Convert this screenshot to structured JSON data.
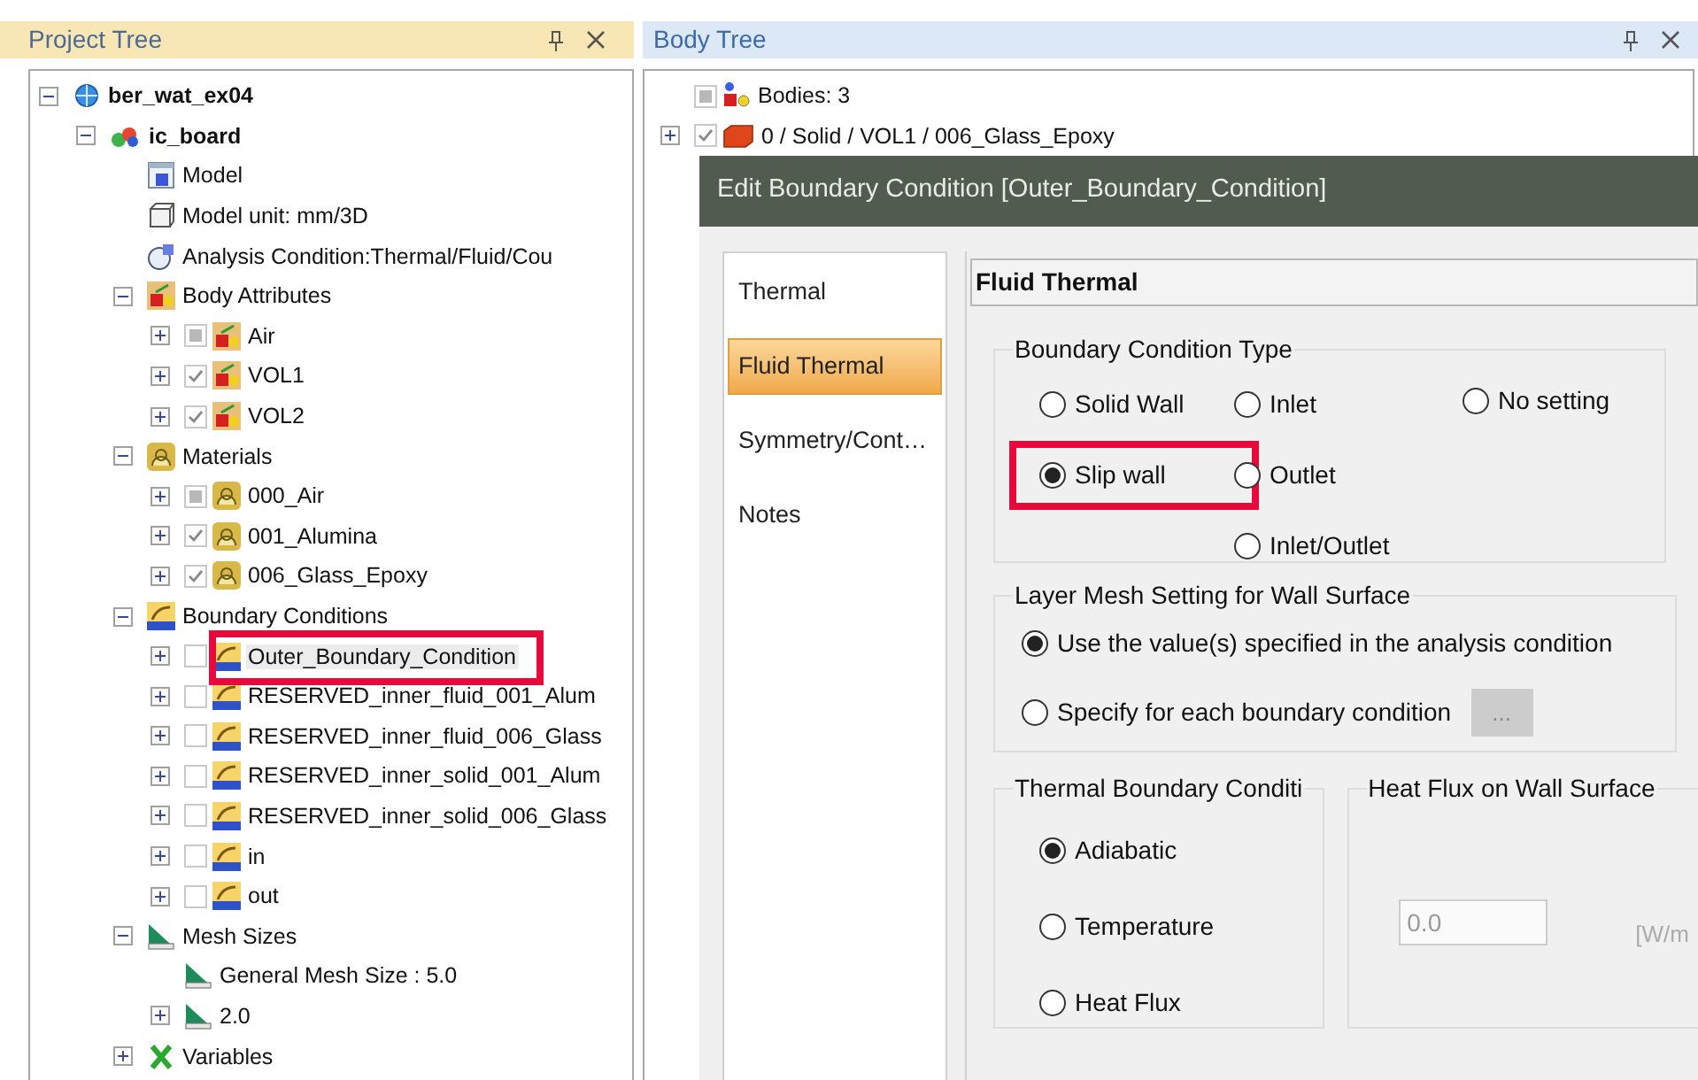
{
  "project_tree": {
    "title": "Project Tree",
    "items": [
      {
        "label": "ber_wat_ex04",
        "kind": "project",
        "bold": true,
        "expanded": true,
        "children": [
          {
            "label": "ic_board",
            "kind": "assembly",
            "bold": true,
            "expanded": true,
            "children": [
              {
                "label": "Model",
                "kind": "model"
              },
              {
                "label": "Model unit: mm/3D",
                "kind": "unit"
              },
              {
                "label": "Analysis Condition:Thermal/Fluid/Cou",
                "kind": "analysis"
              },
              {
                "label": "Body Attributes",
                "kind": "body",
                "expanded": true,
                "children": [
                  {
                    "label": "Air",
                    "kind": "body",
                    "checked": false,
                    "partial": true,
                    "expanded": false
                  },
                  {
                    "label": "VOL1",
                    "kind": "body",
                    "checked": true,
                    "expanded": false
                  },
                  {
                    "label": "VOL2",
                    "kind": "body",
                    "checked": true,
                    "expanded": false
                  }
                ]
              },
              {
                "label": "Materials",
                "kind": "material",
                "expanded": true,
                "children": [
                  {
                    "label": "000_Air",
                    "kind": "material",
                    "checked": false,
                    "partial": true,
                    "expanded": false
                  },
                  {
                    "label": "001_Alumina",
                    "kind": "material",
                    "checked": true,
                    "expanded": false
                  },
                  {
                    "label": "006_Glass_Epoxy",
                    "kind": "material",
                    "checked": true,
                    "expanded": false
                  }
                ]
              },
              {
                "label": "Boundary Conditions",
                "kind": "boundary",
                "expanded": true,
                "children": [
                  {
                    "label": "Outer_Boundary_Condition",
                    "kind": "boundary",
                    "checked": false,
                    "expanded": false,
                    "selected": true,
                    "highlighted": true
                  },
                  {
                    "label": "RESERVED_inner_fluid_001_Alum",
                    "kind": "boundary",
                    "checked": false,
                    "expanded": false,
                    "selected": false
                  },
                  {
                    "label": "RESERVED_inner_fluid_006_Glass",
                    "kind": "boundary",
                    "checked": false,
                    "expanded": false,
                    "selected": false
                  },
                  {
                    "label": "RESERVED_inner_solid_001_Alum",
                    "kind": "boundary",
                    "checked": false,
                    "expanded": false,
                    "selected": false
                  },
                  {
                    "label": "RESERVED_inner_solid_006_Glass",
                    "kind": "boundary",
                    "checked": false,
                    "expanded": false,
                    "selected": false
                  },
                  {
                    "label": "in",
                    "kind": "boundary",
                    "checked": false,
                    "expanded": false,
                    "selected": false
                  },
                  {
                    "label": "out",
                    "kind": "boundary",
                    "checked": false,
                    "expanded": false,
                    "selected": false
                  }
                ]
              },
              {
                "label": "Mesh Sizes",
                "kind": "mesh",
                "expanded": true,
                "children": [
                  {
                    "label": "General Mesh Size : 5.0",
                    "kind": "mesh"
                  },
                  {
                    "label": "2.0",
                    "kind": "mesh",
                    "expanded": false
                  }
                ]
              },
              {
                "label": "Variables",
                "kind": "variables",
                "expanded": false
              }
            ]
          }
        ]
      }
    ]
  },
  "body_tree": {
    "title": "Body Tree",
    "items": [
      {
        "label": "Bodies: 3",
        "kind": "bodies",
        "checked": false,
        "partial": true
      },
      {
        "label": "0 / Solid / VOL1 / 006_Glass_Epoxy",
        "kind": "solid",
        "checked": true,
        "expanded": false
      }
    ]
  },
  "dialog": {
    "title": "Edit Boundary Condition [Outer_Boundary_Condition]",
    "nav": [
      {
        "label": "Thermal",
        "selected": false
      },
      {
        "label": "Fluid Thermal",
        "selected": true
      },
      {
        "label": "Symmetry/Cont…",
        "selected": false
      },
      {
        "label": "Notes",
        "selected": false
      }
    ],
    "panel_title": "Fluid Thermal",
    "boundary_condition_type": {
      "title": "Boundary Condition Type",
      "columns": [
        [
          {
            "label": "Solid Wall",
            "selected": false
          },
          {
            "label": "Slip wall",
            "selected": true,
            "highlighted": true
          }
        ],
        [
          {
            "label": "Inlet",
            "selected": false
          },
          {
            "label": "Outlet",
            "selected": false
          },
          {
            "label": "Inlet/Outlet",
            "selected": false
          }
        ],
        [
          {
            "label": "No setting",
            "selected": false
          }
        ]
      ]
    },
    "layer_mesh": {
      "title": "Layer Mesh Setting for Wall Surface",
      "options": [
        {
          "label": "Use the value(s) specified in the analysis condition",
          "selected": true
        },
        {
          "label": "Specify for each boundary condition",
          "selected": false
        }
      ],
      "button": {
        "label": "...",
        "disabled": true
      }
    },
    "thermal_boundary": {
      "title": "Thermal Boundary Conditi",
      "options": [
        {
          "label": "Adiabatic",
          "selected": true
        },
        {
          "label": "Temperature",
          "selected": false
        },
        {
          "label": "Heat Flux",
          "selected": false
        }
      ]
    },
    "heat_flux": {
      "title": "Heat Flux on Wall Surface",
      "value": "0.0",
      "unit": "[W/m",
      "disabled": true
    }
  }
}
